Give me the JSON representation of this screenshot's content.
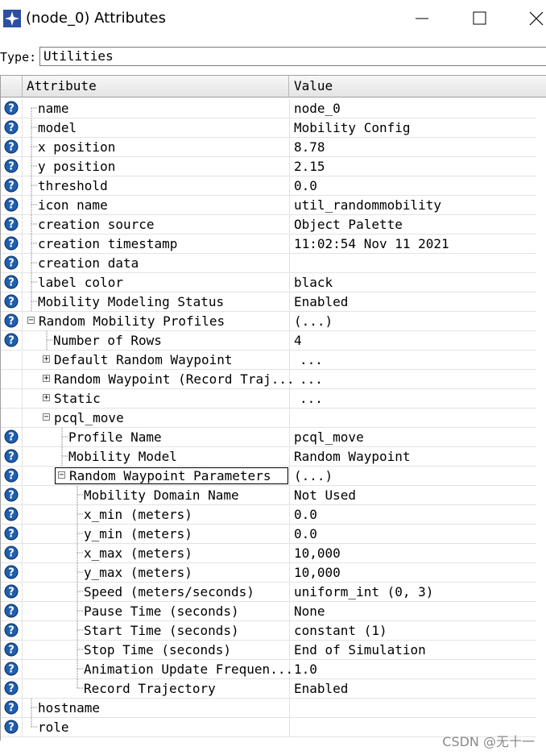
{
  "window": {
    "title": "(node_0) Attributes",
    "icon": "star-app-icon"
  },
  "type_row": {
    "label": "Type:",
    "value": "Utilities"
  },
  "table": {
    "headers": {
      "attribute": "Attribute",
      "value": "Value"
    },
    "rows": [
      {
        "label": "name",
        "value": "node_0",
        "level": 0,
        "help": true,
        "expander": "",
        "tree": "first"
      },
      {
        "label": "model",
        "value": "Mobility Config",
        "level": 0,
        "help": true,
        "expander": "",
        "tree": "mid"
      },
      {
        "label": "x position",
        "value": "8.78",
        "level": 0,
        "help": true,
        "expander": "",
        "tree": "mid"
      },
      {
        "label": "y position",
        "value": "2.15",
        "level": 0,
        "help": true,
        "expander": "",
        "tree": "mid"
      },
      {
        "label": "threshold",
        "value": "0.0",
        "level": 0,
        "help": true,
        "expander": "",
        "tree": "mid"
      },
      {
        "label": "icon name",
        "value": "util_randommobility",
        "level": 0,
        "help": true,
        "expander": "",
        "tree": "mid"
      },
      {
        "label": "creation source",
        "value": "Object Palette",
        "level": 0,
        "help": true,
        "expander": "",
        "tree": "mid"
      },
      {
        "label": "creation timestamp",
        "value": "11:02:54 Nov 11 2021",
        "level": 0,
        "help": true,
        "expander": "",
        "tree": "mid"
      },
      {
        "label": "creation data",
        "value": "",
        "level": 0,
        "help": true,
        "expander": "",
        "tree": "mid"
      },
      {
        "label": "label color",
        "value": "black",
        "level": 0,
        "help": true,
        "expander": "",
        "tree": "mid"
      },
      {
        "label": "Mobility Modeling Status",
        "value": "Enabled",
        "level": 0,
        "help": true,
        "expander": "",
        "tree": "mid"
      },
      {
        "label": "Random Mobility Profiles",
        "value": "(...)",
        "level": 0,
        "help": true,
        "expander": "minus",
        "tree": "none"
      },
      {
        "label": "Number of Rows",
        "value": "4",
        "level": 1,
        "help": true,
        "expander": "",
        "tree": "mid"
      },
      {
        "label": "Default Random Waypoint",
        "value": "...",
        "level": 1,
        "help": false,
        "expander": "plus",
        "tree": "none"
      },
      {
        "label": "Random Waypoint (Record Traj...",
        "value": "...",
        "level": 1,
        "help": false,
        "expander": "plus",
        "tree": "none"
      },
      {
        "label": "Static",
        "value": "...",
        "level": 1,
        "help": false,
        "expander": "plus",
        "tree": "none"
      },
      {
        "label": "pcql_move",
        "value": "",
        "level": 1,
        "help": false,
        "expander": "minus",
        "tree": "none"
      },
      {
        "label": "Profile Name",
        "value": "pcql_move",
        "level": 2,
        "help": true,
        "expander": "",
        "tree": "mid"
      },
      {
        "label": "Mobility Model",
        "value": "Random Waypoint",
        "level": 2,
        "help": true,
        "expander": "",
        "tree": "mid"
      },
      {
        "label": "Random Waypoint Parameters",
        "value": "(...)",
        "level": 2,
        "help": true,
        "expander": "minus",
        "tree": "none",
        "selected": true
      },
      {
        "label": "Mobility Domain Name",
        "value": "Not Used",
        "level": 3,
        "help": true,
        "expander": "",
        "tree": "mid"
      },
      {
        "label": "x_min (meters)",
        "value": "0.0",
        "level": 3,
        "help": true,
        "expander": "",
        "tree": "mid"
      },
      {
        "label": "y_min (meters)",
        "value": "0.0",
        "level": 3,
        "help": true,
        "expander": "",
        "tree": "mid"
      },
      {
        "label": "x_max (meters)",
        "value": "10,000",
        "level": 3,
        "help": true,
        "expander": "",
        "tree": "mid"
      },
      {
        "label": "y_max (meters)",
        "value": "10,000",
        "level": 3,
        "help": true,
        "expander": "",
        "tree": "mid"
      },
      {
        "label": "Speed (meters/seconds)",
        "value": "uniform_int (0, 3)",
        "level": 3,
        "help": true,
        "expander": "",
        "tree": "mid"
      },
      {
        "label": "Pause Time (seconds)",
        "value": "None",
        "level": 3,
        "help": true,
        "expander": "",
        "tree": "mid"
      },
      {
        "label": "Start Time (seconds)",
        "value": "constant (1)",
        "level": 3,
        "help": true,
        "expander": "",
        "tree": "mid"
      },
      {
        "label": "Stop Time (seconds)",
        "value": "End of Simulation",
        "level": 3,
        "help": true,
        "expander": "",
        "tree": "mid"
      },
      {
        "label": "Animation Update Frequen...",
        "value": "1.0",
        "level": 3,
        "help": true,
        "expander": "",
        "tree": "mid"
      },
      {
        "label": "Record Trajectory",
        "value": "Enabled",
        "level": 3,
        "help": true,
        "expander": "",
        "tree": "last"
      },
      {
        "label": "hostname",
        "value": "",
        "level": 0,
        "help": true,
        "expander": "",
        "tree": "mid"
      },
      {
        "label": "role",
        "value": "",
        "level": 0,
        "help": true,
        "expander": "",
        "tree": "last"
      }
    ]
  },
  "watermark": "CSDN @无十一",
  "colors": {
    "help_icon_fill": "#1f5fae",
    "app_icon_fill": "#2d4fa3",
    "grid_line": "#e3e3e3",
    "header_bg": "#e9e9e9"
  }
}
